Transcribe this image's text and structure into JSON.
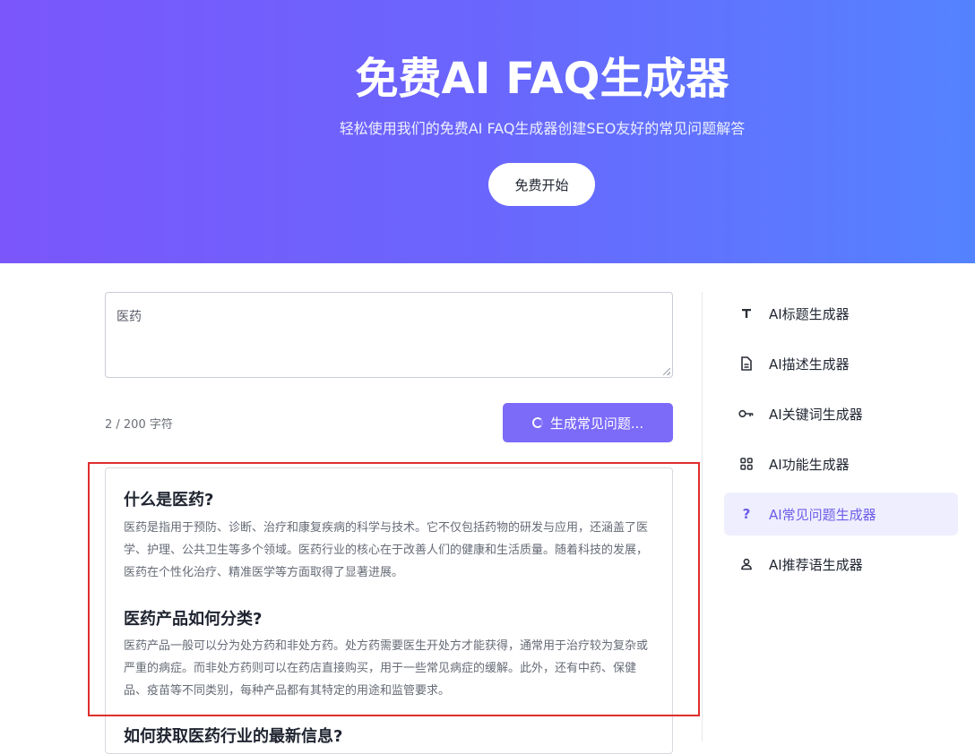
{
  "hero": {
    "title": "免费AI FAQ生成器",
    "subtitle": "轻松使用我们的免费AI FAQ生成器创建SEO友好的常见问题解答",
    "cta_label": "免费开始"
  },
  "input": {
    "value": "医药",
    "char_count": "2 / 200 字符"
  },
  "generate_button": {
    "label": "生成常见问题..."
  },
  "faqs": [
    {
      "question": "什么是医药?",
      "answer": "医药是指用于预防、诊断、治疗和康复疾病的科学与技术。它不仅包括药物的研发与应用，还涵盖了医学、护理、公共卫生等多个领域。医药行业的核心在于改善人们的健康和生活质量。随着科技的发展，医药在个性化治疗、精准医学等方面取得了显著进展。"
    },
    {
      "question": "医药产品如何分类?",
      "answer": "医药产品一般可以分为处方药和非处方药。处方药需要医生开处方才能获得，通常用于治疗较为复杂或严重的病症。而非处方药则可以在药店直接购买，用于一些常见病症的缓解。此外，还有中药、保健品、疫苗等不同类别，每种产品都有其特定的用途和监管要求。"
    },
    {
      "question": "如何获取医药行业的最新信息?",
      "answer": ""
    }
  ],
  "sidebar": {
    "items": [
      {
        "label": "AI标题生成器",
        "icon": "title-icon",
        "active": false
      },
      {
        "label": "AI描述生成器",
        "icon": "document-icon",
        "active": false
      },
      {
        "label": "AI关键词生成器",
        "icon": "key-icon",
        "active": false
      },
      {
        "label": "AI功能生成器",
        "icon": "grid-icon",
        "active": false
      },
      {
        "label": "AI常见问题生成器",
        "icon": "question-icon",
        "active": true
      },
      {
        "label": "AI推荐语生成器",
        "icon": "user-icon",
        "active": false
      }
    ]
  },
  "colors": {
    "hero_gradient_start": "#7b56fb",
    "hero_gradient_end": "#5483ff",
    "accent": "#7c6af9",
    "active_bg": "#efeefe",
    "highlight": "#e02d2d"
  }
}
